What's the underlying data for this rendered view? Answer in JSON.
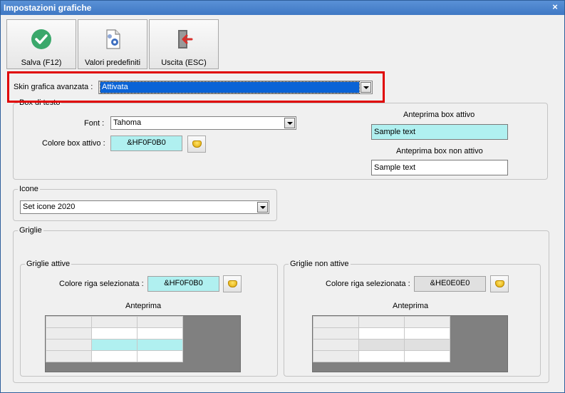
{
  "window": {
    "title": "Impostazioni grafiche",
    "close_glyph": "×"
  },
  "toolbar": {
    "save_label": "Salva (F12)",
    "defaults_label": "Valori predefiniti",
    "exit_label": "Uscita (ESC)"
  },
  "skin": {
    "label": "Skin grafica avanzata :",
    "value": "Attivata"
  },
  "textbox_group": {
    "title": "Box di testo",
    "font_label": "Font :",
    "font_value": "Tahoma",
    "active_color_label": "Colore box attivo :",
    "active_color_value": "&HF0F0B0",
    "active_color_hex": "#b0f0f0",
    "preview_active_label": "Anteprima box attivo",
    "preview_active_text": "Sample text",
    "preview_inactive_label": "Anteprima box non attivo",
    "preview_inactive_text": "Sample text"
  },
  "icons_group": {
    "title": "Icone",
    "value": "Set icone 2020"
  },
  "grids_group": {
    "title": "Griglie",
    "active": {
      "title": "Griglie attive",
      "row_label": "Colore riga selezionata :",
      "row_value": "&HF0F0B0",
      "row_hex": "#b0f0f0",
      "preview_label": "Anteprima",
      "preview_selected_bg": "#b0f0f0",
      "preview_row_bg": "#ffffff"
    },
    "inactive": {
      "title": "Griglie non attive",
      "row_label": "Colore riga selezionata :",
      "row_value": "&HE0E0E0",
      "row_hex": "#e0e0e0",
      "preview_label": "Anteprima",
      "preview_selected_bg": "#e0e0e0",
      "preview_row_bg": "#ffffff"
    }
  },
  "colors": {
    "highlight": "#e00000",
    "title_bar": "#3f78c4",
    "skin_selected": "#0a63d6"
  }
}
